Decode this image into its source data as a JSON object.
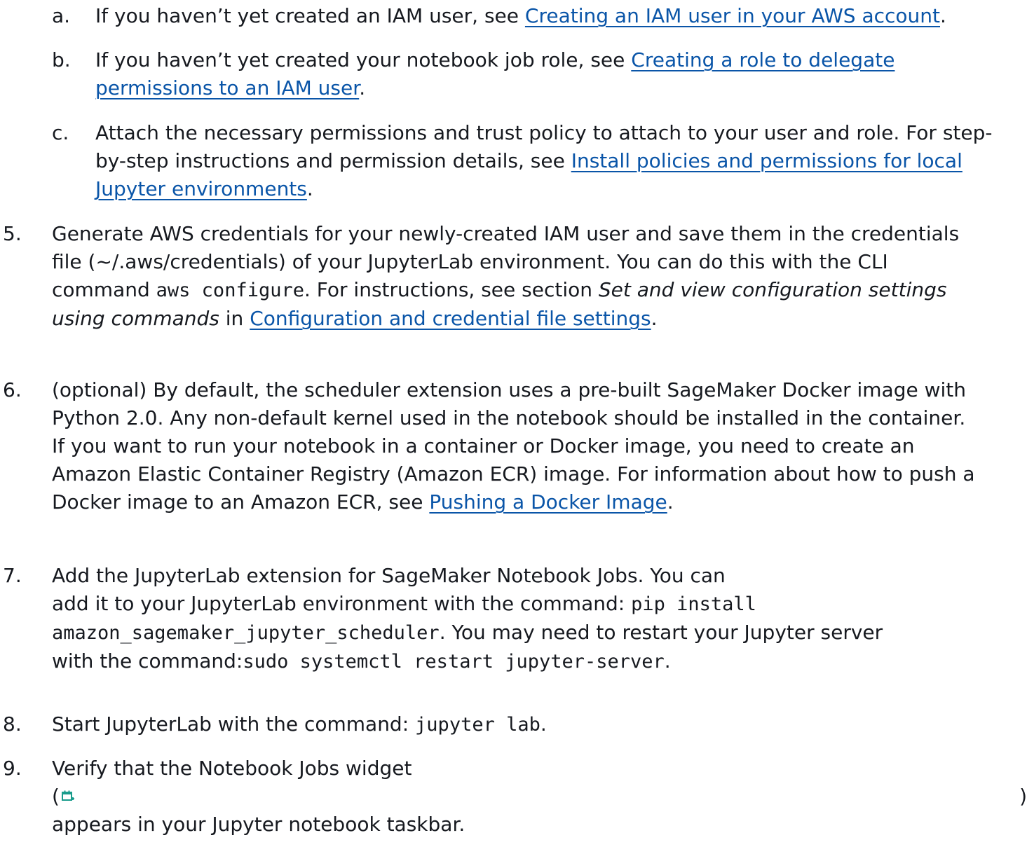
{
  "steps": {
    "a": {
      "marker": "a.",
      "text1": "If you haven’t yet created an IAM user, see ",
      "link": "Creating an IAM user in your AWS account",
      "text2": "."
    },
    "b": {
      "marker": "b.",
      "text1": "If you haven’t yet created your notebook job role, see ",
      "link_part1": "Creating a role to delegate",
      "link_part2": "permissions to an IAM user",
      "text2": "."
    },
    "c": {
      "marker": "c.",
      "line1": "Attach the necessary permissions and trust policy to attach to your user and role. For step-",
      "text1": "by-step instructions and permission details, see ",
      "link_part1": "Install policies and permissions for local",
      "link_part2": "Jupyter environments",
      "text2": "."
    },
    "s5": {
      "marker": "5.",
      "line1": "Generate AWS credentials for your newly-created IAM user and save them in the credentials",
      "line2": "file (~/.aws/credentials) of your JupyterLab environment. You can do this with the CLI",
      "text1": "command ",
      "code1": "aws configure",
      "text2": ". For instructions, see section ",
      "em1": "Set and view configuration settings",
      "em2": "using commands",
      "text3": " in ",
      "link": "Configuration and credential file settings",
      "text4": "."
    },
    "s6": {
      "marker": "6.",
      "line1": "(optional) By default, the scheduler extension uses a pre-built SageMaker Docker image with",
      "line2": "Python 2.0. Any non-default kernel used in the notebook should be installed in the container.",
      "line3": "If you want to run your notebook in a container or Docker image, you need to create an",
      "line4": "Amazon Elastic Container Registry (Amazon ECR) image. For information about how to push a",
      "text1": "Docker image to an Amazon ECR, see ",
      "link": "Pushing a Docker Image",
      "text2": "."
    },
    "s7": {
      "marker": "7.",
      "line1": "Add the JupyterLab extension for SageMaker Notebook Jobs. You can",
      "text1": "add it to your JupyterLab environment with the command: ",
      "code1": "pip install",
      "code2": "amazon_sagemaker_jupyter_scheduler",
      "text2": ". You may need to restart your Jupyter server",
      "text3": "with the command:",
      "code3": "sudo systemctl restart jupyter-server",
      "text4": "."
    },
    "s8": {
      "marker": "8.",
      "text1": "Start JupyterLab with the command: ",
      "code1": "jupyter lab",
      "text2": "."
    },
    "s9": {
      "marker": "9.",
      "line1": "Verify that the Notebook Jobs widget",
      "open_paren": "(",
      "close_paren": ")",
      "line3": "appears in your Jupyter notebook taskbar."
    }
  },
  "colors": {
    "text": "#16191f",
    "link": "#0a55a8",
    "icon": "#1a9c8c"
  },
  "icons": {
    "widget": "notebook-jobs-calendar-icon"
  }
}
